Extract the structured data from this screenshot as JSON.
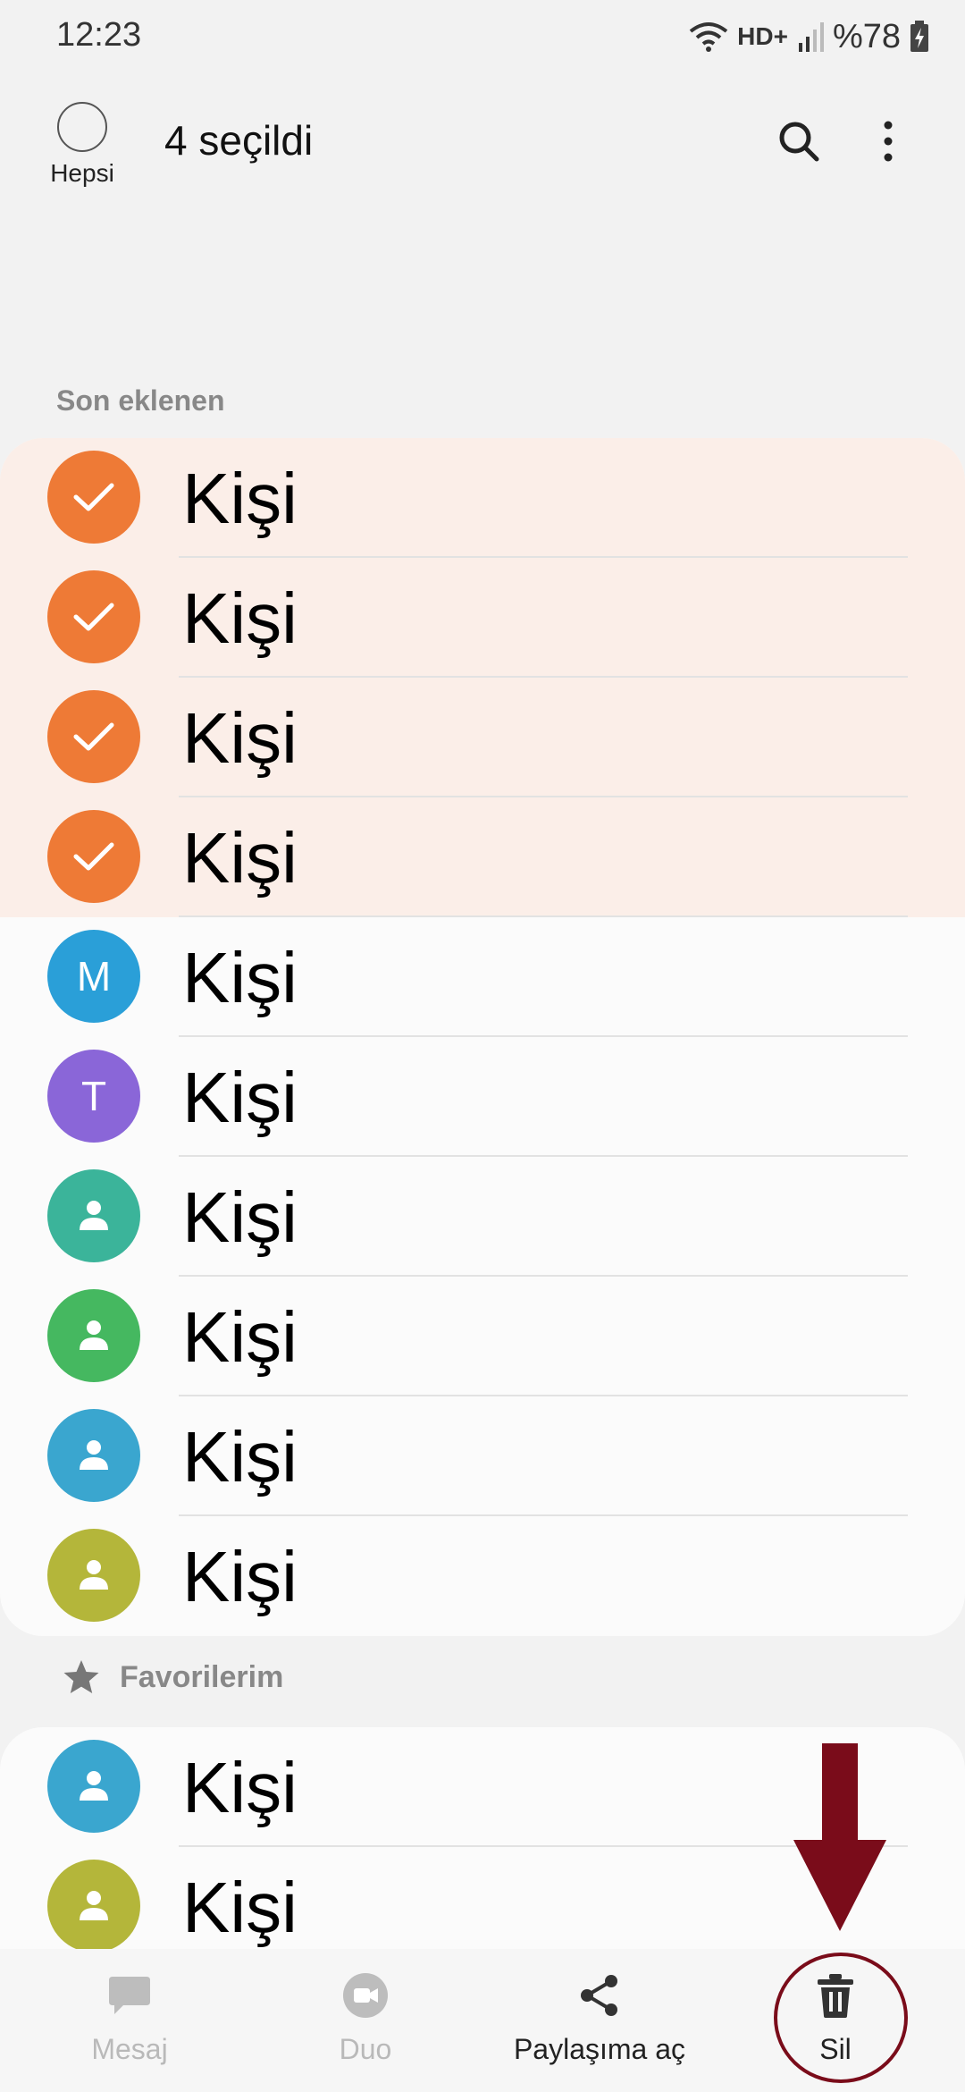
{
  "status_bar": {
    "time": "12:23",
    "network": "HD+",
    "battery": "%78"
  },
  "top_bar": {
    "select_all_label": "Hepsi",
    "selected_count_text": "4 seçildi"
  },
  "recent_section": {
    "title": "Son eklenen",
    "contacts": [
      {
        "name": "Kişi",
        "selected": true,
        "avatar": "check-icon",
        "color": "#ee7a36"
      },
      {
        "name": "Kişi",
        "selected": true,
        "avatar": "check-icon",
        "color": "#ee7a36"
      },
      {
        "name": "Kişi",
        "selected": true,
        "avatar": "check-icon",
        "color": "#ee7a36"
      },
      {
        "name": "Kişi",
        "selected": true,
        "avatar": "check-icon",
        "color": "#ee7a36"
      },
      {
        "name": "Kişi",
        "selected": false,
        "initial": "M",
        "color": "#2a9fd8"
      },
      {
        "name": "Kişi",
        "selected": false,
        "initial": "T",
        "color": "#8a66d8"
      },
      {
        "name": "Kişi",
        "selected": false,
        "avatar": "person-icon",
        "color": "#3bb49a"
      },
      {
        "name": "Kişi",
        "selected": false,
        "avatar": "person-icon",
        "color": "#45b860"
      },
      {
        "name": "Kişi",
        "selected": false,
        "avatar": "person-icon",
        "color": "#3aa6cf"
      },
      {
        "name": "Kişi",
        "selected": false,
        "avatar": "person-icon",
        "color": "#b4b63a"
      }
    ]
  },
  "favorites_section": {
    "title": "Favorilerim",
    "contacts": [
      {
        "name": "Kişi",
        "avatar": "person-icon",
        "color": "#3aa6cf"
      },
      {
        "name": "Kişi",
        "avatar": "person-icon",
        "color": "#b4b63a"
      }
    ]
  },
  "bottom_bar": {
    "message_label": "Mesaj",
    "duo_label": "Duo",
    "share_label": "Paylaşıma aç",
    "delete_label": "Sil"
  },
  "colors": {
    "selected_row_bg": "#fbeee8",
    "annotation": "#7a0c1a"
  }
}
